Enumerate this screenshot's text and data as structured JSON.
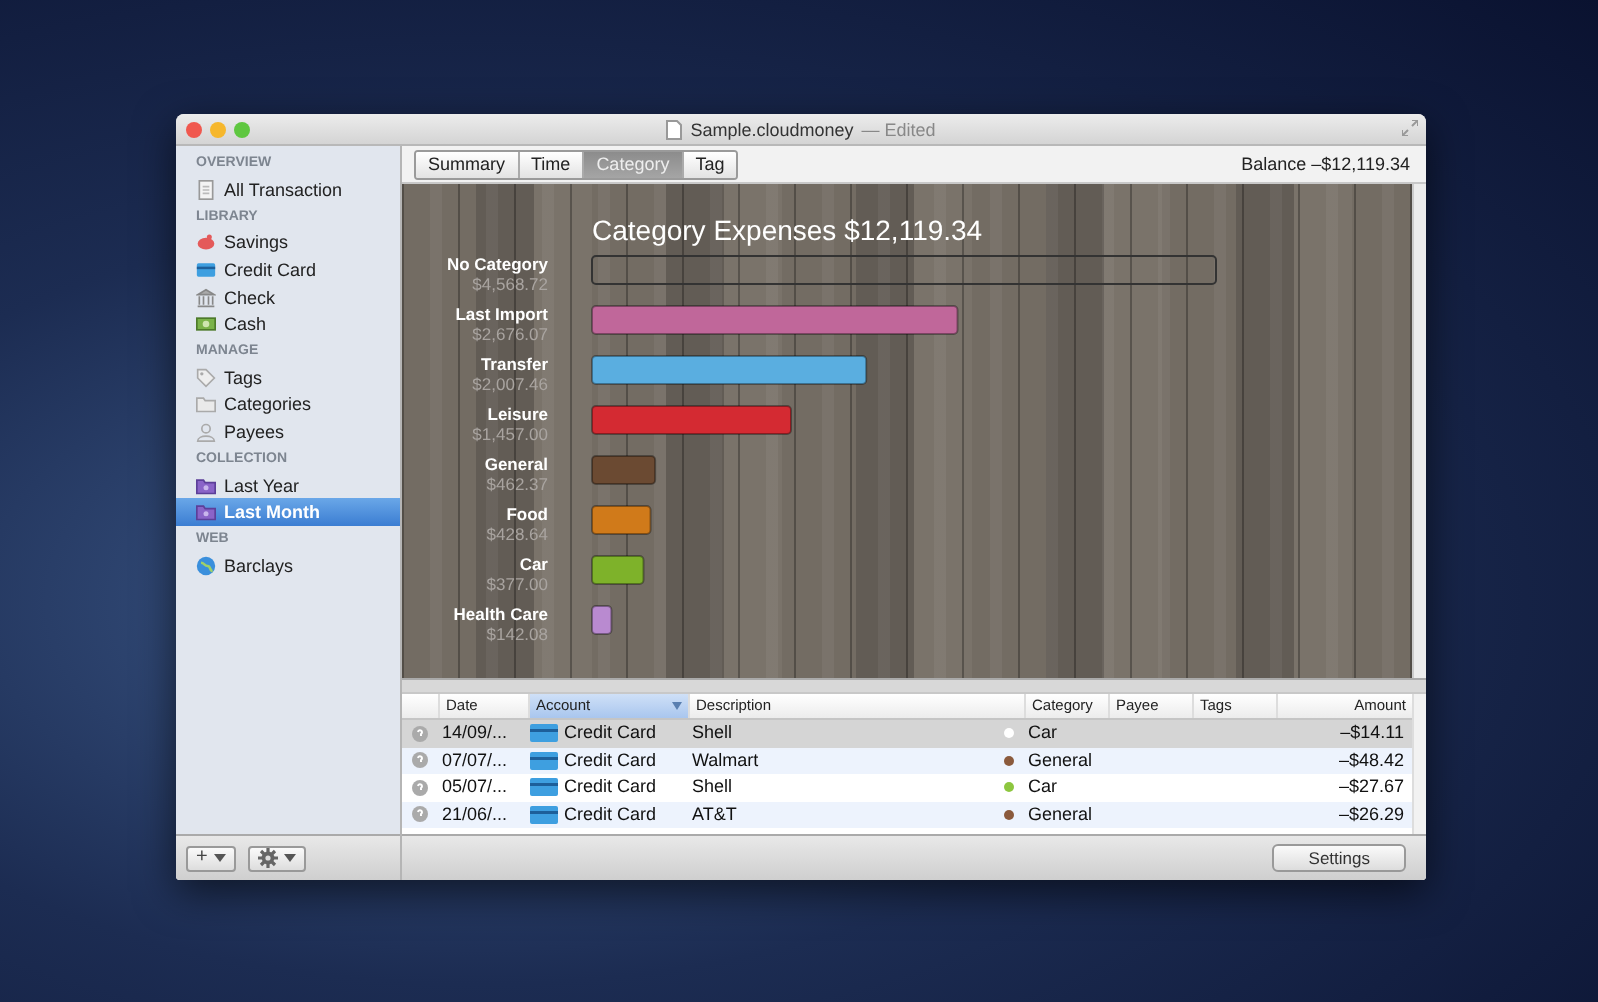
{
  "window": {
    "title": "Sample.cloudmoney",
    "status": "— Edited"
  },
  "sidebar": {
    "sections": [
      {
        "heading": "OVERVIEW",
        "items": [
          {
            "label": "All Transaction",
            "kind": "document",
            "selected": false
          }
        ]
      },
      {
        "heading": "LIBRARY",
        "items": [
          {
            "label": "Savings",
            "kind": "piggy",
            "selected": false
          },
          {
            "label": "Credit Card",
            "kind": "card",
            "selected": false
          },
          {
            "label": "Check",
            "kind": "bank",
            "selected": false
          },
          {
            "label": "Cash",
            "kind": "cash",
            "selected": false
          }
        ]
      },
      {
        "heading": "MANAGE",
        "items": [
          {
            "label": "Tags",
            "kind": "tag",
            "selected": false
          },
          {
            "label": "Categories",
            "kind": "folder",
            "selected": false
          },
          {
            "label": "Payees",
            "kind": "person",
            "selected": false
          }
        ]
      },
      {
        "heading": "COLLECTION",
        "items": [
          {
            "label": "Last Year",
            "kind": "collection",
            "selected": false
          },
          {
            "label": "Last Month",
            "kind": "collection",
            "selected": true
          }
        ]
      },
      {
        "heading": "WEB",
        "items": [
          {
            "label": "Barclays",
            "kind": "globe",
            "selected": false
          }
        ]
      }
    ],
    "add_button": "+"
  },
  "tabs": [
    {
      "label": "Summary",
      "selected": false
    },
    {
      "label": "Time",
      "selected": false
    },
    {
      "label": "Category",
      "selected": true
    },
    {
      "label": "Tag",
      "selected": false
    }
  ],
  "balance": "Balance –$12,119.34",
  "chart_data": {
    "type": "bar",
    "orientation": "horizontal",
    "title": "Category Expenses $12,119.34",
    "categories": [
      "No Category",
      "Last Import",
      "Transfer",
      "Leisure",
      "General",
      "Food",
      "Car",
      "Health Care"
    ],
    "values": [
      4568.72,
      2676.07,
      2007.46,
      1457.0,
      462.37,
      428.64,
      377.0,
      142.08
    ],
    "colors": [
      null,
      "#c0679a",
      "#5aaee0",
      "#d42a32",
      "#6b4a32",
      "#d07a1a",
      "#7eb22a",
      "#b98ad0"
    ],
    "value_labels": [
      "$4,568.72",
      "$2,676.07",
      "$2,007.46",
      "$1,457.00",
      "$462.37",
      "$428.64",
      "$377.00",
      "$142.08"
    ]
  },
  "table": {
    "columns": [
      {
        "label": "Date",
        "sorted": false
      },
      {
        "label": "Account",
        "sorted": true
      },
      {
        "label": "Description",
        "sorted": false
      },
      {
        "label": "Category",
        "sorted": false
      },
      {
        "label": "Payee",
        "sorted": false
      },
      {
        "label": "Tags",
        "sorted": false
      },
      {
        "label": "Amount",
        "sorted": false
      }
    ],
    "rows": [
      {
        "date": "14/09/...",
        "account": "Credit Card",
        "description": "Shell",
        "category": "Car",
        "color": "#ffffff",
        "amount": "–$14.11",
        "selected": true
      },
      {
        "date": "07/07/...",
        "account": "Credit Card",
        "description": "Walmart",
        "category": "General",
        "color": "#8b5a3c",
        "amount": "–$48.42",
        "selected": false
      },
      {
        "date": "05/07/...",
        "account": "Credit Card",
        "description": "Shell",
        "category": "Car",
        "color": "#8dc63f",
        "amount": "–$27.67",
        "selected": false
      },
      {
        "date": "21/06/...",
        "account": "Credit Card",
        "description": "AT&T",
        "category": "General",
        "color": "#8b5a3c",
        "amount": "–$26.29",
        "selected": false
      }
    ]
  },
  "settings_button": "Settings"
}
